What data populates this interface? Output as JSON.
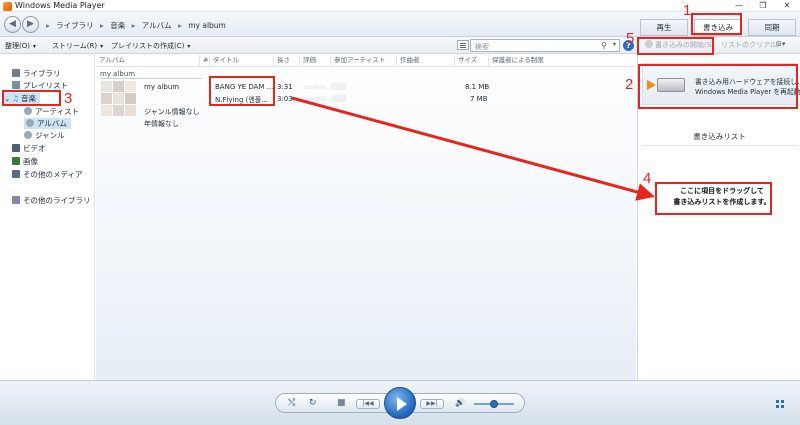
{
  "window": {
    "title": "Windows Media Player",
    "controls": [
      "—",
      "❐",
      "✕"
    ]
  },
  "nav": {
    "breadcrumbs": [
      "ライブラリ",
      "音楽",
      "アルバム",
      "my album"
    ],
    "sep": "▸"
  },
  "tabs": [
    {
      "label": "再生"
    },
    {
      "label": "書き込み"
    },
    {
      "label": "同期"
    }
  ],
  "toolbar": {
    "organize": "整理(O)",
    "stream": "ストリーム(R)",
    "create_playlist": "プレイリストの作成(C)",
    "chevron": "▾",
    "search_placeholder": "検索",
    "help": "?",
    "start_burn": "書き込みの開始(S)",
    "clear_list": "リストのクリア(L)"
  },
  "sidebar": {
    "items": [
      {
        "label": "ライブラリ",
        "icon": "library-icon",
        "color": "#6f7f93"
      },
      {
        "label": "プレイリスト",
        "icon": "playlist-icon",
        "color": "#7c8da3"
      },
      {
        "label": "音楽",
        "icon": "music-note-icon",
        "color": "#3a75c4",
        "arrow": "⌄"
      },
      {
        "label": "アーティスト",
        "icon": "artist-icon",
        "color": "#9aa8b8"
      },
      {
        "label": "アルバム",
        "icon": "album-icon",
        "color": "#9aa8b8"
      },
      {
        "label": "ジャンル",
        "icon": "genre-icon",
        "color": "#9aa8b8"
      },
      {
        "label": "ビデオ",
        "icon": "video-icon",
        "color": "#4c5e73"
      },
      {
        "label": "画像",
        "icon": "image-icon",
        "color": "#3b7a3b"
      },
      {
        "label": "その他のメディア",
        "icon": "other-media-icon",
        "color": "#5a6c82"
      },
      {
        "label": "その他のライブラリ",
        "icon": "other-library-icon",
        "color": "#7c8da3"
      }
    ]
  },
  "columns": [
    "アルバム",
    "#",
    "タイトル",
    "長さ",
    "評価",
    "参加アーティスト",
    "作曲者",
    "サイズ",
    "保護者による制限"
  ],
  "album": {
    "group_label": "my album",
    "name": "my album",
    "genre": "ジャンル情報なし",
    "year": "年情報なし"
  },
  "tracks": [
    {
      "title": "BANG YE DAM ...",
      "length": "3:31",
      "rating": "☆☆☆☆☆",
      "size": "8.1 MB"
    },
    {
      "title": "N.Flying (엔플...",
      "length": "3:03",
      "rating": "☆☆☆☆☆",
      "size": "7 MB"
    }
  ],
  "burn_panel": {
    "device_text_1": "書き込み用ハードウェアを接続し、",
    "device_text_2": "Windows Media Player を再起動し",
    "list_title": "書き込みリスト",
    "hint_1": "ここに項目をドラッグして",
    "hint_2": "書き込みリストを作成します。"
  },
  "player": {
    "shuffle": "⤭",
    "repeat": "↻",
    "stop": "■",
    "prev": "|◀◀",
    "next": "▶▶|",
    "volume": "🔊"
  },
  "annotations": [
    "1",
    "2",
    "3",
    "4",
    "5"
  ],
  "colors": {
    "annotation": "#e8241e",
    "accent": "#2d6db5",
    "arrow": "#f08a1b"
  }
}
